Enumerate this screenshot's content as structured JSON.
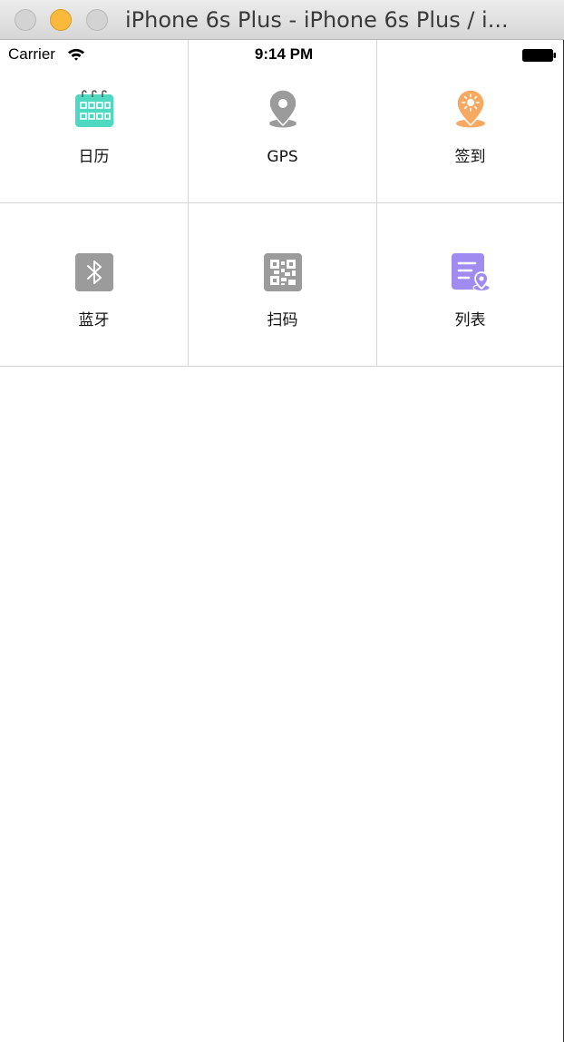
{
  "window": {
    "title": "iPhone 6s Plus - iPhone 6s Plus / i..."
  },
  "status_bar": {
    "carrier": "Carrier",
    "time": "9:14 PM"
  },
  "grid": {
    "items": [
      {
        "label": "日历",
        "icon": "calendar-icon",
        "color": "#4fd9c0"
      },
      {
        "label": "GPS",
        "icon": "map-pin-icon",
        "color": "#9b9b9b"
      },
      {
        "label": "签到",
        "icon": "check-in-pin-icon",
        "color": "#f7a962"
      },
      {
        "label": "蓝牙",
        "icon": "bluetooth-icon",
        "color": "#9b9b9b"
      },
      {
        "label": "扫码",
        "icon": "qr-code-icon",
        "color": "#9b9b9b"
      },
      {
        "label": "列表",
        "icon": "list-location-icon",
        "color": "#a08cf0"
      }
    ]
  }
}
